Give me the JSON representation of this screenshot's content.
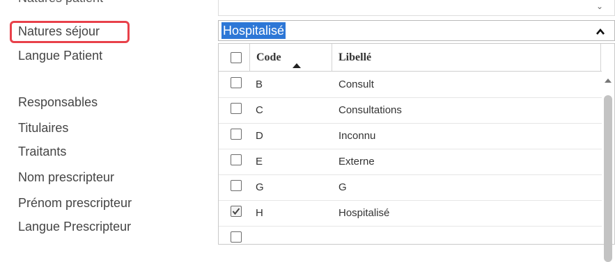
{
  "left_labels": {
    "cut_top": "Natures patient",
    "natures_sejour": "Natures séjour",
    "langue_patient": "Langue Patient",
    "responsables": "Responsables",
    "titulaires": "Titulaires",
    "traitants": "Traitants",
    "nom_prescripteur": "Nom prescripteur",
    "prenom_prescripteur": "Prénom prescripteur",
    "langue_prescripteur": "Langue Prescripteur"
  },
  "combo": {
    "selected_value": "Hospitalisé"
  },
  "grid": {
    "headers": {
      "code": "Code",
      "libelle": "Libellé"
    },
    "sort": {
      "column": "code",
      "direction": "ascending"
    },
    "rows": [
      {
        "code": "B",
        "libelle": "Consult",
        "checked": false
      },
      {
        "code": "C",
        "libelle": "Consultations",
        "checked": false
      },
      {
        "code": "D",
        "libelle": "Inconnu",
        "checked": false
      },
      {
        "code": "E",
        "libelle": "Externe",
        "checked": false
      },
      {
        "code": "G",
        "libelle": "G",
        "checked": false
      },
      {
        "code": "H",
        "libelle": "Hospitalisé",
        "checked": true
      }
    ]
  },
  "colors": {
    "highlight_border": "#e8414a",
    "selection_background": "#2d77d6"
  },
  "icons": {
    "collapse": "chevron-up-icon",
    "sort": "sort-ascending-icon",
    "checkbox_checked": "checkmark-icon"
  }
}
